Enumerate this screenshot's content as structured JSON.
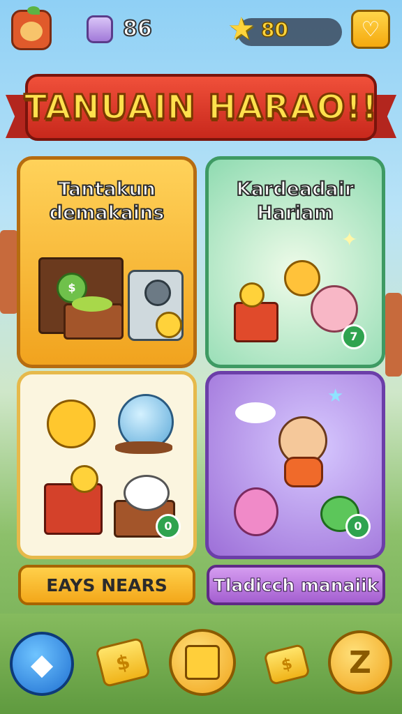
{
  "header": {
    "gem_count": "86",
    "star_count": "80",
    "gem_icon": "gem-bag-icon",
    "star_icon": "star-icon",
    "heart_icon": "heart-icon",
    "avatar_icon": "fox-avatar-icon"
  },
  "banner": {
    "title": "TANUAIN HARAO!!"
  },
  "cards": [
    {
      "title_line1": "Tantakun",
      "title_line2": "demakains"
    },
    {
      "title_line1": "Kardeadair",
      "title_line2": "Hariam"
    },
    {
      "title_line1": "",
      "title_line2": ""
    },
    {
      "title_line1": "",
      "title_line2": ""
    }
  ],
  "buttons": {
    "left_label": "EAYS NEARS",
    "right_label": "Tladicch manaiik"
  },
  "badges": {
    "card2_badge": "7",
    "card3_badge": "0",
    "card4_badge": "0"
  },
  "bottom_nav": {
    "diamond_icon": "diamond-icon",
    "coin_stack_left_icon": "dollar-coin-stack-icon",
    "box_icon": "gift-box-icon",
    "coin_stack_right_icon": "dollar-coin-stack-icon",
    "coin_label": "$",
    "z_icon": "z-coin-icon"
  },
  "colors": {
    "banner_red": "#d8321f",
    "title_yellow": "#ffe14d",
    "card_orange": "#f1a31e",
    "card_green": "#8fdbb1",
    "card_purple": "#9d6fd8"
  }
}
